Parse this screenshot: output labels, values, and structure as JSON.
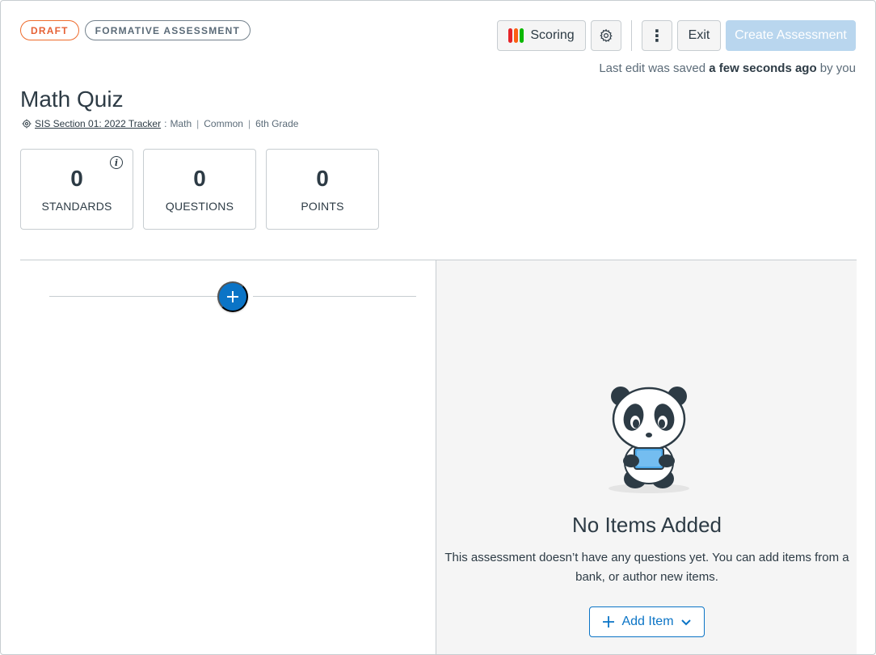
{
  "status_pills": {
    "draft": "DRAFT",
    "type": "FORMATIVE ASSESSMENT"
  },
  "toolbar": {
    "scoring_label": "Scoring",
    "scoring_colors": [
      "#e62429",
      "#fc5e13",
      "#0bb800"
    ],
    "more_label": "⋮",
    "exit_label": "Exit",
    "create_label": "Create Assessment"
  },
  "save_status": {
    "prefix": "Last edit was saved",
    "time": "a few seconds ago",
    "suffix": "by you"
  },
  "assessment": {
    "title": "Math Quiz",
    "section_link": "SIS Section 01: 2022 Tracker",
    "subject": "Math",
    "category": "Common",
    "grade": "6th Grade"
  },
  "stats": [
    {
      "value": "0",
      "label": "STANDARDS"
    },
    {
      "value": "0",
      "label": "QUESTIONS"
    },
    {
      "value": "0",
      "label": "POINTS"
    }
  ],
  "empty_state": {
    "title": "No Items Added",
    "description": "This assessment doesn’t have any questions yet. You can add items from a bank, or author new items.",
    "add_item_label": "Add Item"
  }
}
